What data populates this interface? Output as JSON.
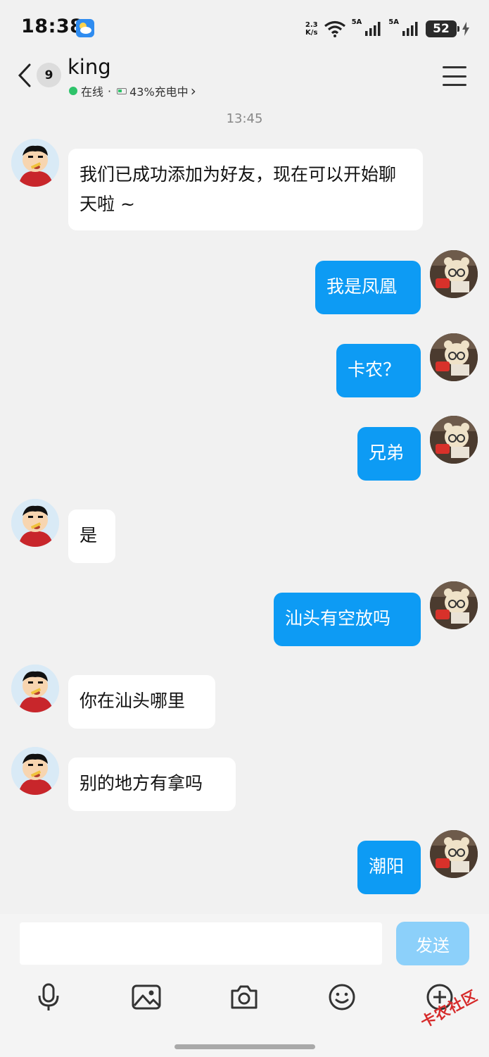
{
  "status_bar": {
    "time": "18:38",
    "net_speed_value": "2.3",
    "net_speed_unit": "K/s",
    "signal_1": "5A",
    "signal_2": "5A",
    "battery": "52"
  },
  "header": {
    "unread_count": "9",
    "contact_name": "king",
    "online_text": "在线",
    "separator": "·",
    "device_status": "43%充电中",
    "chevron": "›"
  },
  "chat": {
    "timestamp": "13:45",
    "messages": [
      {
        "side": "left",
        "text": "我们已成功添加为好友，现在可以开始聊天啦 ~"
      },
      {
        "side": "right",
        "text": "我是凤凰"
      },
      {
        "side": "right",
        "text": "卡农？"
      },
      {
        "side": "right",
        "text": "兄弟"
      },
      {
        "side": "left",
        "text": "是"
      },
      {
        "side": "right",
        "text": "汕头有空放吗"
      },
      {
        "side": "left",
        "text": "你在汕头哪里"
      },
      {
        "side": "left",
        "text": "别的地方有拿吗"
      },
      {
        "side": "right",
        "text": "潮阳"
      }
    ]
  },
  "input": {
    "placeholder": "",
    "send_label": "发送"
  },
  "toolbar": [
    "mic-icon",
    "image-icon",
    "camera-icon",
    "emoji-icon",
    "plus-icon"
  ],
  "watermark": "卡农社区",
  "colors": {
    "background": "#f1f1f1",
    "bubble_right": "#0d9bf4",
    "bubble_left": "#ffffff",
    "send_button": "#8cd0fa",
    "online": "#2ec36a"
  }
}
